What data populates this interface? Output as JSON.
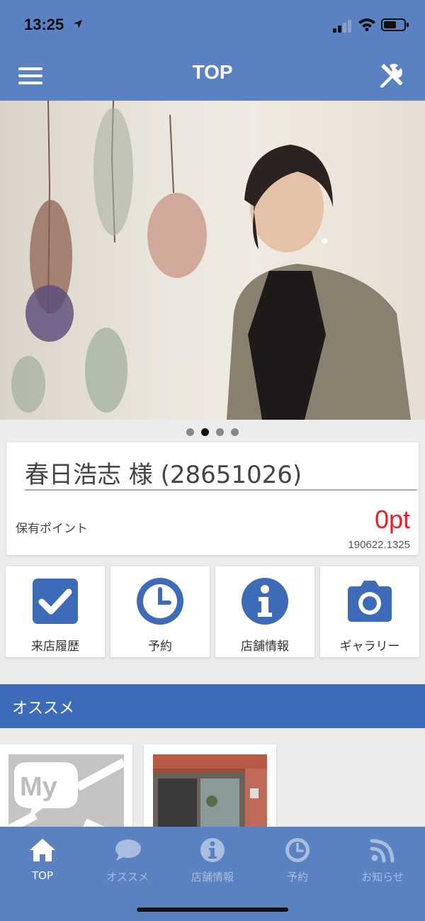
{
  "status_bar": {
    "time": "13:25"
  },
  "nav": {
    "title": "TOP"
  },
  "carousel": {
    "slide_count": 4,
    "active_index": 1
  },
  "profile": {
    "name": "春日浩志 様 (28651026)",
    "points_label": "保有ポイント",
    "points_value": "0pt",
    "points_timestamp": "190622.1325"
  },
  "quick_menu": [
    {
      "label": "来店履歴",
      "icon": "checkbox-icon"
    },
    {
      "label": "予約",
      "icon": "clock-icon"
    },
    {
      "label": "店舗情報",
      "icon": "info-icon"
    },
    {
      "label": "ギャラリー",
      "icon": "camera-icon"
    }
  ],
  "recommend": {
    "title": "オススメ"
  },
  "tabs": [
    {
      "label": "TOP",
      "icon": "home-icon",
      "active": true
    },
    {
      "label": "オススメ",
      "icon": "chat-bubble-icon",
      "active": false
    },
    {
      "label": "店舗情報",
      "icon": "info-icon",
      "active": false
    },
    {
      "label": "予約",
      "icon": "clock-icon",
      "active": false
    },
    {
      "label": "お知らせ",
      "icon": "rss-icon",
      "active": false
    }
  ],
  "colors": {
    "primary": "#5a81c1",
    "section_header": "#3e6bb8",
    "icon_blue": "#3e6bb8",
    "points_red": "#e8202a"
  }
}
